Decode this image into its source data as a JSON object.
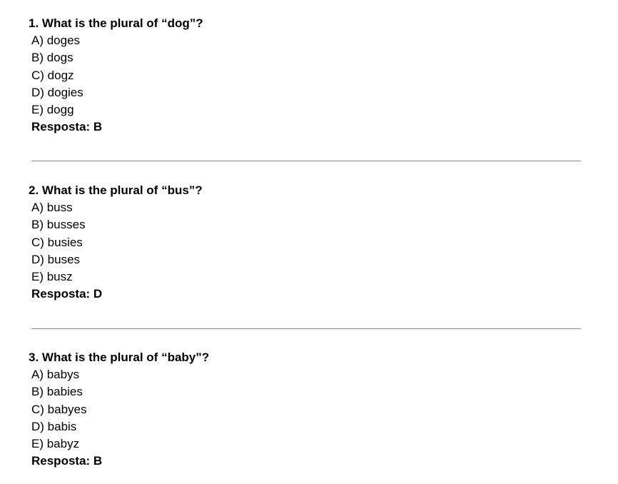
{
  "questions": [
    {
      "title": "1. What is the plural of “dog”?",
      "options": [
        "A) doges",
        "B) dogs",
        "C) dogz",
        "D) dogies",
        "E) dogg"
      ],
      "answer": "Resposta: B"
    },
    {
      "title": "2. What is the plural of “bus”?",
      "options": [
        "A) buss",
        "B) busses",
        "C) busies",
        "D) buses",
        "E) busz"
      ],
      "answer": "Resposta: D"
    },
    {
      "title": "3. What is the plural of “baby”?",
      "options": [
        "A) babys",
        "B) babies",
        "C) babyes",
        "D) babis",
        "E) babyz"
      ],
      "answer": "Resposta: B"
    }
  ]
}
